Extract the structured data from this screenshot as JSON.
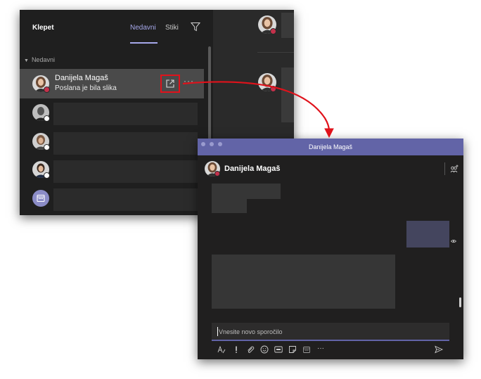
{
  "main_window": {
    "pane_title": "Klepet",
    "tabs": [
      {
        "label": "Nedavni",
        "active": true
      },
      {
        "label": "Stiki",
        "active": false
      }
    ],
    "section_label": "Nedavni",
    "active_chat": {
      "name": "Danijela Magaš",
      "preview": "Poslana je bila slika",
      "more": "···"
    },
    "accent_color": "#a6a8ea"
  },
  "popout_window": {
    "title": "Danijela Magaš",
    "header_name": "Danijela Magaš",
    "compose_placeholder": "Vnesite novo sporočilo",
    "toolbar": {
      "more": "···"
    },
    "titlebar_color": "#6264a7"
  },
  "icons": [
    "filter-icon",
    "popout-icon",
    "add-people-icon",
    "format-icon",
    "important-icon",
    "attach-icon",
    "emoji-icon",
    "gif-icon",
    "sticker-icon",
    "schedule-meeting-icon",
    "send-icon",
    "seen-icon",
    "calendar-icon"
  ],
  "annotation_color": "#e0121b"
}
